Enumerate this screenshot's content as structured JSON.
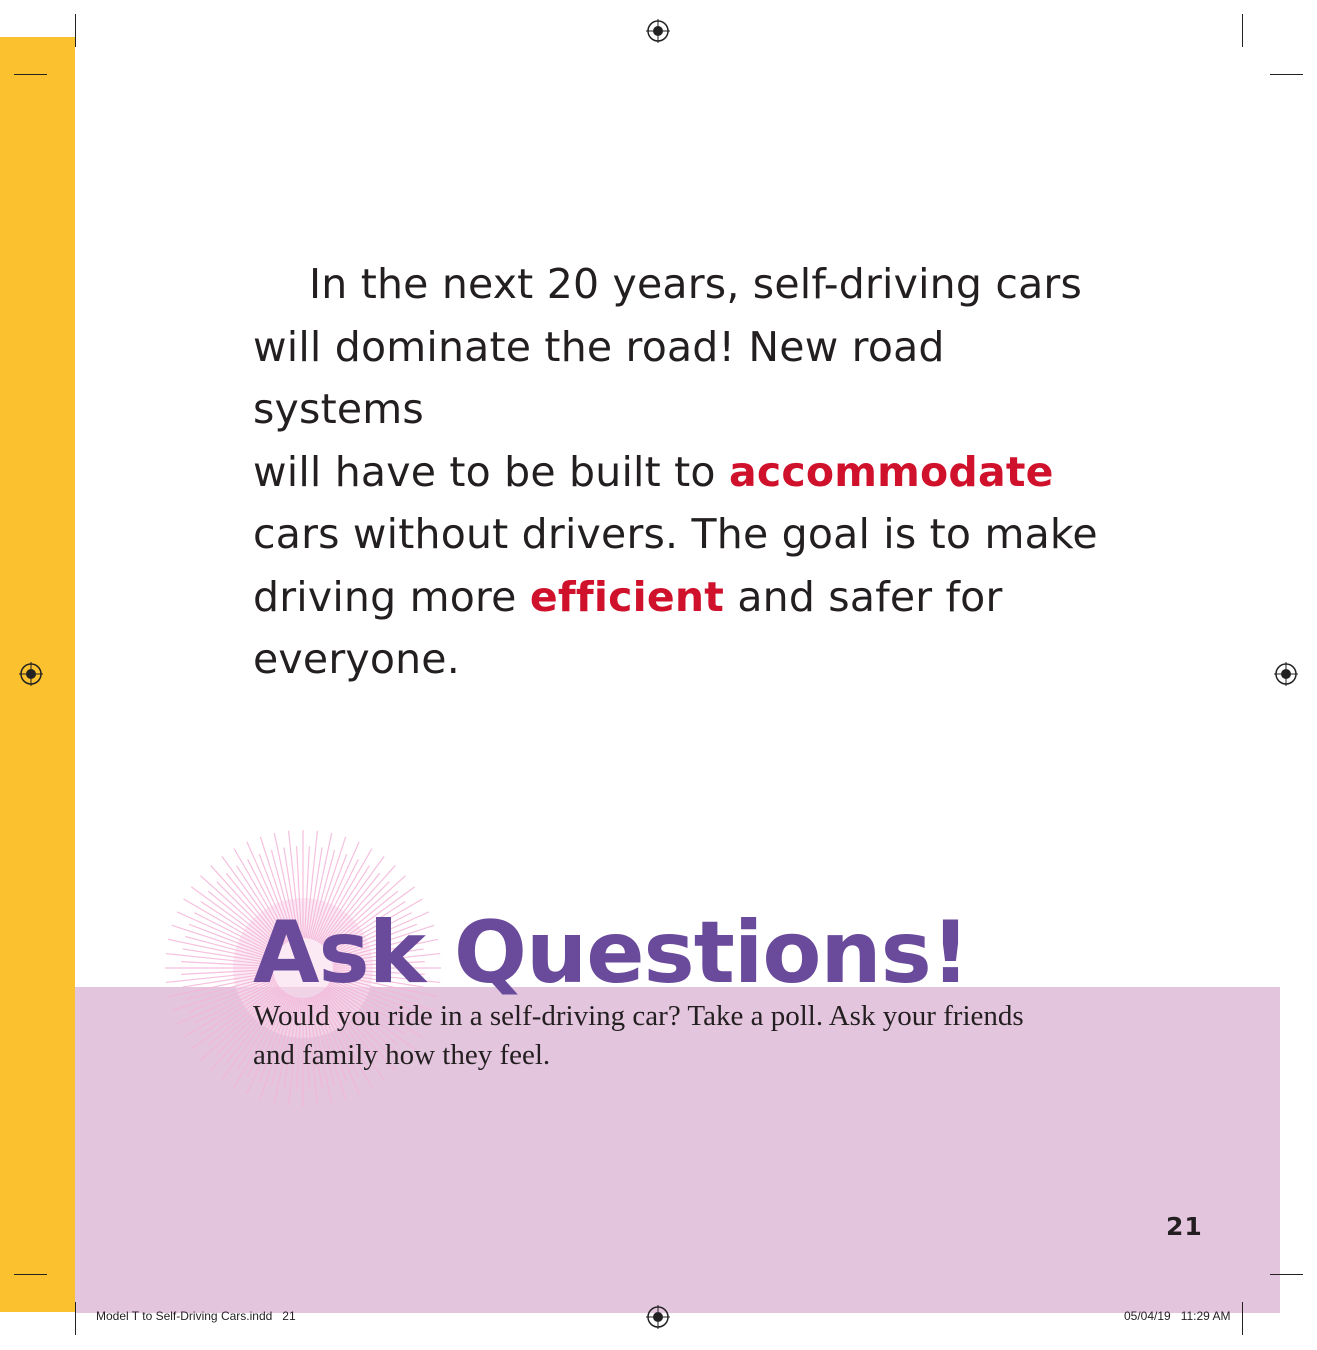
{
  "body": {
    "line1": "In the next 20 years, self-driving cars",
    "line2": "will dominate the road! New road systems",
    "line3_before": "will have to be built to ",
    "vocab_accommodate": "accommodate",
    "line4": "cars without drivers. The goal is to make",
    "line5_before": "driving more ",
    "vocab_efficient": "efficient",
    "line5_after": " and safer for",
    "line6": "everyone."
  },
  "ask_questions": {
    "title": "Ask Questions!",
    "line1": "Would you ride in a self-driving car? Take a poll. Ask your friends",
    "line2": "and family how they feel."
  },
  "page_number": "21",
  "slug": {
    "file": "Model T to Self-Driving Cars.indd   21",
    "date": "05/04/19   11:29 AM"
  },
  "colors": {
    "side_strip": "#fbc12f",
    "panel": "#e4c5de",
    "vocab": "#d0112b",
    "title": "#6a4a9b",
    "burst": "#f4b5d8"
  }
}
